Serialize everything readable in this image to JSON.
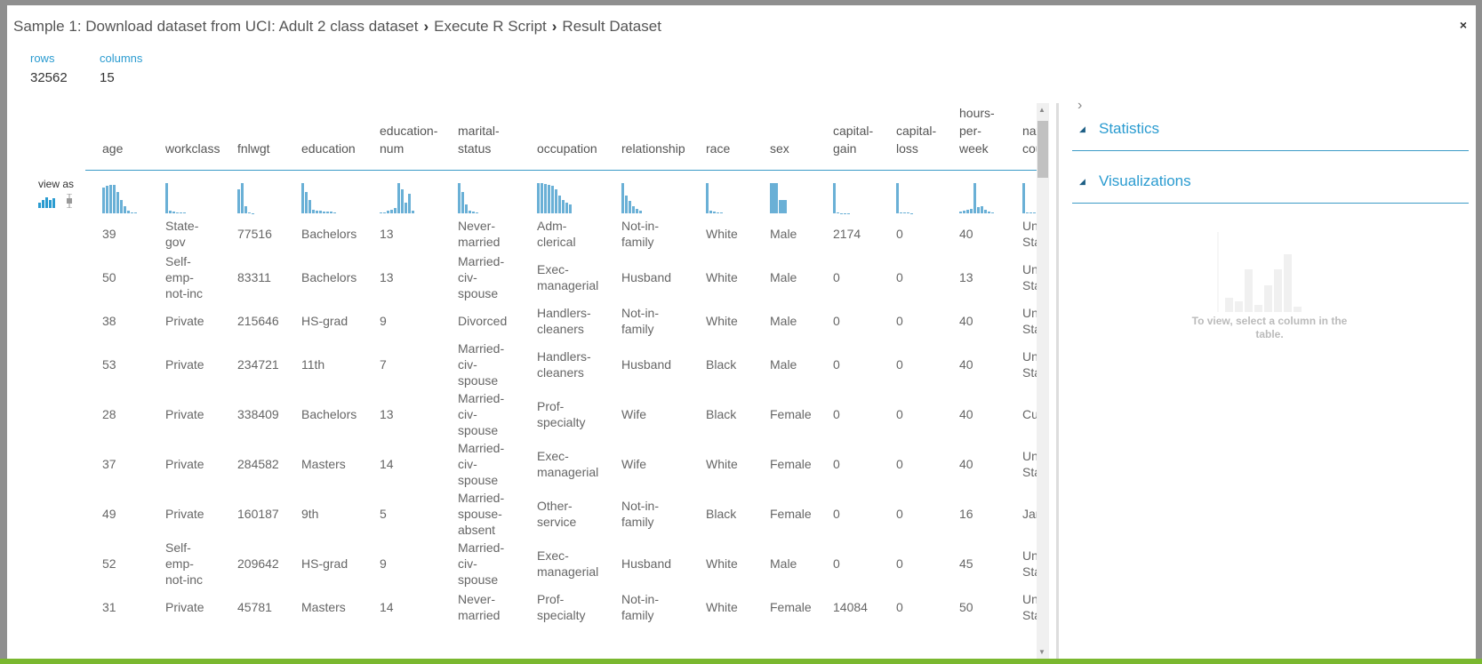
{
  "title": {
    "crumbs": [
      "Sample 1: Download dataset from UCI: Adult 2 class dataset",
      "Execute R Script",
      "Result Dataset"
    ],
    "close": "×"
  },
  "summary": {
    "rows_label": "rows",
    "rows": "32562",
    "columns_label": "columns",
    "columns": "15"
  },
  "view_as": "view as",
  "columns": [
    "age",
    "workclass",
    "fnlwgt",
    "education",
    "education-\nnum",
    "marital-\nstatus",
    "occupation",
    "relationship",
    "race",
    "sex",
    "capital-\ngain",
    "capital-\nloss",
    "hours-\nper-\nweek",
    "native-\ncountry"
  ],
  "histograms": [
    [
      85,
      90,
      95,
      95,
      70,
      45,
      25,
      8,
      3,
      2
    ],
    [
      100,
      8,
      5,
      4,
      3,
      3
    ],
    [
      80,
      100,
      25,
      3,
      1
    ],
    [
      100,
      70,
      45,
      12,
      10,
      8,
      7,
      6,
      5,
      4
    ],
    [
      2,
      4,
      10,
      12,
      18,
      100,
      80,
      35,
      65,
      8
    ],
    [
      100,
      70,
      30,
      8,
      6,
      3
    ],
    [
      100,
      100,
      98,
      95,
      90,
      80,
      60,
      45,
      35,
      28
    ],
    [
      100,
      60,
      40,
      25,
      15,
      8
    ],
    [
      100,
      8,
      5,
      3,
      2
    ],
    [
      100,
      45
    ],
    [
      100,
      2,
      1,
      1,
      1
    ],
    [
      100,
      3,
      2,
      2,
      1
    ],
    [
      5,
      8,
      12,
      15,
      100,
      20,
      25,
      12,
      5,
      3
    ],
    [
      100,
      3,
      2,
      2,
      1
    ]
  ],
  "rows": [
    [
      "39",
      "State-\ngov",
      "77516",
      "Bachelors",
      "13",
      "Never-\nmarried",
      "Adm-\nclerical",
      "Not-in-\nfamily",
      "White",
      "Male",
      "2174",
      "0",
      "40",
      "Unit\nStat"
    ],
    [
      "50",
      "Self-\nemp-\nnot-inc",
      "83311",
      "Bachelors",
      "13",
      "Married-\nciv-\nspouse",
      "Exec-\nmanagerial",
      "Husband",
      "White",
      "Male",
      "0",
      "0",
      "13",
      "Unit\nStat"
    ],
    [
      "38",
      "Private",
      "215646",
      "HS-grad",
      "9",
      "Divorced",
      "Handlers-\ncleaners",
      "Not-in-\nfamily",
      "White",
      "Male",
      "0",
      "0",
      "40",
      "Unit\nStat"
    ],
    [
      "53",
      "Private",
      "234721",
      "11th",
      "7",
      "Married-\nciv-\nspouse",
      "Handlers-\ncleaners",
      "Husband",
      "Black",
      "Male",
      "0",
      "0",
      "40",
      "Unit\nStat"
    ],
    [
      "28",
      "Private",
      "338409",
      "Bachelors",
      "13",
      "Married-\nciv-\nspouse",
      "Prof-\nspecialty",
      "Wife",
      "Black",
      "Female",
      "0",
      "0",
      "40",
      "Cub"
    ],
    [
      "37",
      "Private",
      "284582",
      "Masters",
      "14",
      "Married-\nciv-\nspouse",
      "Exec-\nmanagerial",
      "Wife",
      "White",
      "Female",
      "0",
      "0",
      "40",
      "Unit\nStat"
    ],
    [
      "49",
      "Private",
      "160187",
      "9th",
      "5",
      "Married-\nspouse-\nabsent",
      "Other-\nservice",
      "Not-in-\nfamily",
      "Black",
      "Female",
      "0",
      "0",
      "16",
      "Jam"
    ],
    [
      "52",
      "Self-\nemp-\nnot-inc",
      "209642",
      "HS-grad",
      "9",
      "Married-\nciv-\nspouse",
      "Exec-\nmanagerial",
      "Husband",
      "White",
      "Male",
      "0",
      "0",
      "45",
      "Unit\nStat"
    ],
    [
      "31",
      "Private",
      "45781",
      "Masters",
      "14",
      "Never-\nmarried",
      "Prof-\nspecialty",
      "Not-in-\nfamily",
      "White",
      "Female",
      "14084",
      "0",
      "50",
      "Unit\nStat"
    ]
  ],
  "right_panel": {
    "expand": "›",
    "statistics": "Statistics",
    "visualizations": "Visualizations",
    "viz_message": "To view, select a column in the table."
  },
  "colors": {
    "accent": "#2a9bd0",
    "hist": "#6ab0d6",
    "green": "#7ab82f"
  }
}
